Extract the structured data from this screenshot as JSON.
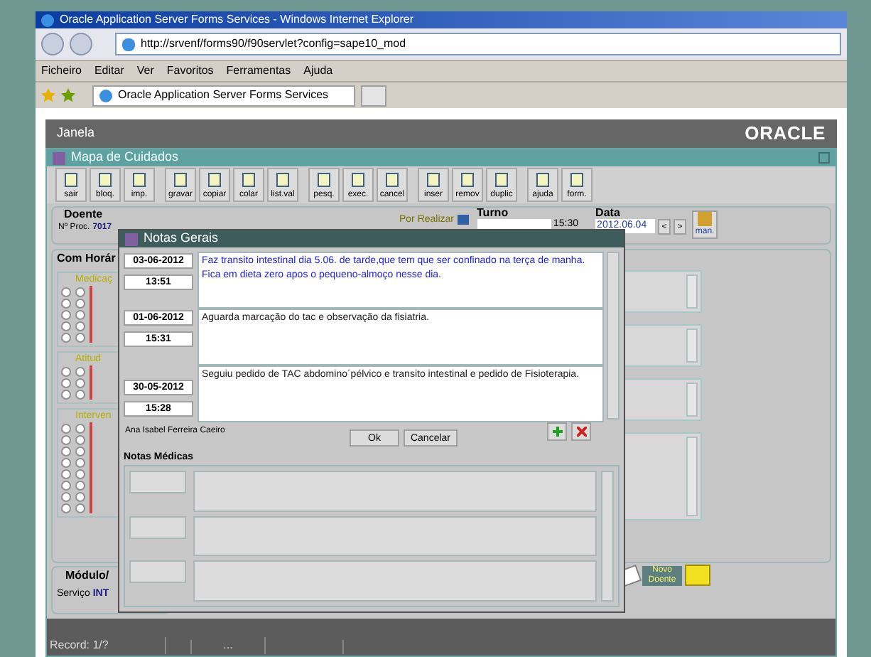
{
  "browser": {
    "title": "Oracle Application Server Forms Services - Windows Internet Explorer",
    "url": "http://srvenf/forms90/f90servlet?config=sape10_mod",
    "menu": [
      "Ficheiro",
      "Editar",
      "Ver",
      "Favoritos",
      "Ferramentas",
      "Ajuda"
    ],
    "tab": "Oracle Application Server Forms Services"
  },
  "app": {
    "menu": "Janela",
    "logo": "ORACLE"
  },
  "form": {
    "title": "Mapa de Cuidados",
    "toolbar": [
      {
        "label": "sair"
      },
      {
        "label": "bloq."
      },
      {
        "label": "imp."
      },
      {
        "label": "gravar"
      },
      {
        "label": "copiar"
      },
      {
        "label": "colar"
      },
      {
        "label": "list.val"
      },
      {
        "label": "pesq."
      },
      {
        "label": "exec."
      },
      {
        "label": "cancel"
      },
      {
        "label": "inser"
      },
      {
        "label": "remov"
      },
      {
        "label": "duplic"
      },
      {
        "label": "ajuda"
      },
      {
        "label": "form."
      }
    ],
    "patient": {
      "heading": "Doente",
      "proc_label": "Nº Proc.",
      "proc_value": "7017",
      "status": "Por Realizar",
      "shift_heading": "Turno",
      "time": "15:30",
      "date_heading": "Data",
      "date": "2012.06.04",
      "prev": "<",
      "next": ">",
      "manual": "man."
    },
    "schedule": {
      "heading": "Com Horár",
      "groups": [
        {
          "label": "Medicaç",
          "rows": [
            {
              "checked": [
                false,
                false
              ]
            },
            {
              "checked": [
                false,
                false
              ]
            },
            {
              "checked": [
                false,
                false
              ]
            },
            {
              "checked": [
                false,
                false
              ]
            },
            {
              "checked": [
                false,
                false
              ]
            }
          ]
        },
        {
          "label": "Atitud",
          "rows": [
            {
              "checked": [
                false,
                false
              ]
            },
            {
              "checked": [
                false,
                false
              ]
            },
            {
              "checked": [
                false,
                false
              ]
            }
          ]
        },
        {
          "label": "Interven",
          "rows": [
            {
              "checked": [
                false,
                false
              ]
            },
            {
              "checked": [
                false,
                false
              ]
            },
            {
              "checked": [
                false,
                false
              ]
            },
            {
              "checked": [
                false,
                false
              ]
            },
            {
              "checked": [
                false,
                false
              ]
            },
            {
              "checked": [
                false,
                false
              ]
            },
            {
              "checked": [
                false,
                false
              ]
            },
            {
              "checked": [
                false,
                false
              ]
            }
          ]
        }
      ]
    },
    "module": {
      "heading": "Módulo/",
      "service_label": "Serviço",
      "service_value": "INT"
    },
    "new_patient": "Novo Doente"
  },
  "dialog": {
    "title": "Notas Gerais",
    "notes": [
      {
        "date": "03-06-2012",
        "time": "13:51",
        "text": "Faz transito intestinal dia 5.06. de tarde,que tem que ser confinado na terça de manha. Fica em dieta zero apos o pequeno-almoço nesse dia.",
        "selected": true
      },
      {
        "date": "01-06-2012",
        "time": "15:31",
        "text": "Aguarda marcação do tac e observação da fisiatria.",
        "selected": false
      },
      {
        "date": "30-05-2012",
        "time": "15:28",
        "text": "Seguiu pedido de TAC abdomino´pélvico e transito intestinal e pedido de Fisioterapia.",
        "selected": false
      }
    ],
    "author": "Ana Isabel Ferreira Caeiro",
    "buttons": [
      "Ok",
      "Cancelar"
    ],
    "medical_heading": "Notas Médicas"
  },
  "status_bar": {
    "record": "Record: 1/?",
    "field_3": "..."
  }
}
